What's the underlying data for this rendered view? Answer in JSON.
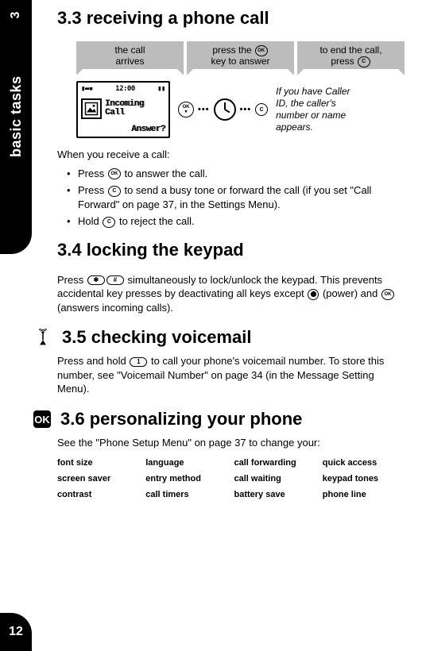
{
  "chapter": {
    "number": "3",
    "title": "basic tasks"
  },
  "page_number": "12",
  "section33": {
    "heading": "3.3   receiving a phone call",
    "steps": {
      "s1a": "the call",
      "s1b": "arrives",
      "s2a": "press the",
      "s2b": "key to answer",
      "s3a": "to end the call,",
      "s3b": "press"
    },
    "phone": {
      "time": "12:00",
      "line1": "Incoming",
      "line2": "Call",
      "answer": "Answer?"
    },
    "sidenote": "If you have Caller ID, the caller's number or name appears.",
    "intro": "When you receive a call:",
    "b1a": "Press ",
    "b1b": " to answer the call.",
    "b2a": "Press ",
    "b2b": " to send a busy tone or forward the call (if you set \"Call Forward\" on page 37, in the Settings Menu).",
    "b3a": "Hold ",
    "b3b": " to reject the call."
  },
  "section34": {
    "heading": "3.4   locking the keypad",
    "p1a": "Press ",
    "p1b": " simultaneously to lock/unlock the keypad. This prevents accidental key presses by deactivating all keys except ",
    "p1c": " (power) and ",
    "p1d": " (answers incoming calls)."
  },
  "section35": {
    "heading": "3.5   checking voicemail",
    "p1a": "Press and hold ",
    "p1b": " to call your phone's voicemail number. To store this number, see \"Voicemail Number\" on page 34 (in the Message Setting Menu).",
    "key1": "1"
  },
  "section36": {
    "heading": "3.6   personalizing your phone",
    "intro": "See the \"Phone Setup Menu\" on page 37 to change your:",
    "items": [
      "font size",
      "language",
      "call forwarding",
      "quick access",
      "screen saver",
      "entry method",
      "call waiting",
      "keypad tones",
      "contrast",
      "call timers",
      "battery save",
      "phone line"
    ]
  },
  "keys": {
    "ok": "OK",
    "c": "C",
    "star": "✱",
    "hash": "#"
  }
}
